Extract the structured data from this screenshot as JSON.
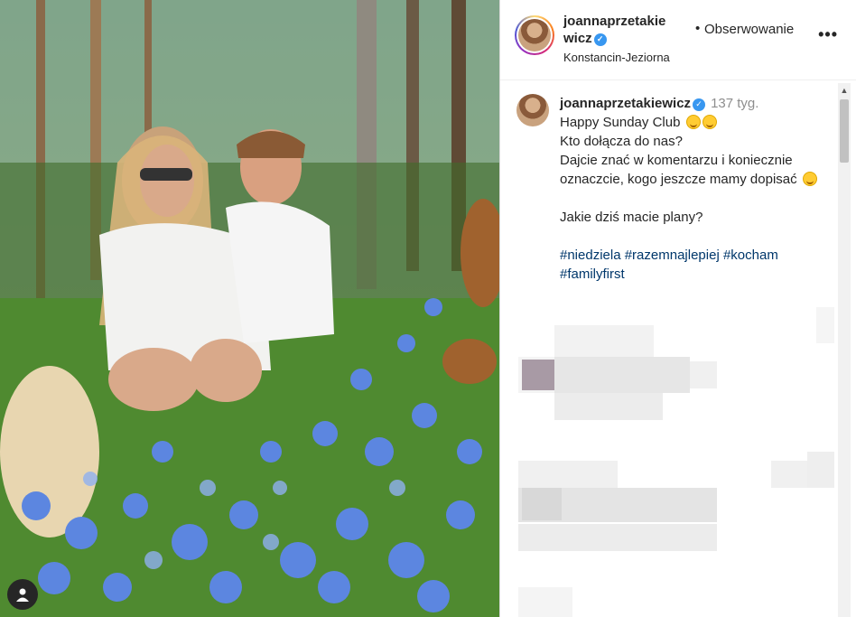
{
  "header": {
    "username": "joannaprzetakiewicz",
    "separator": "•",
    "follow_label": "Obserwowanie",
    "more_label": "•••",
    "location": "Konstancin-Jeziorna",
    "verified_mark": "✓"
  },
  "comment": {
    "username": "joannaprzetakiewicz",
    "time": "137 tyg.",
    "line1": "Happy Sunday Club",
    "line2": "Kto dołącza do nas?",
    "line3": "Dajcie znać w komentarzu i koniecznie oznaczcie, kogo jeszcze mamy dopisać",
    "line4": "Jakie dziś macie plany?",
    "hashtags1": "#niedziela #razemnajlepiej #kocham",
    "hashtags2": "#familyfirst"
  },
  "icons": {
    "scroll_up": "▲",
    "user_tag": "user-icon",
    "emoji": "hugging-face-emoji"
  },
  "colors": {
    "link": "#00376b",
    "verified": "#3897f0",
    "muted": "#8e8e8e"
  }
}
